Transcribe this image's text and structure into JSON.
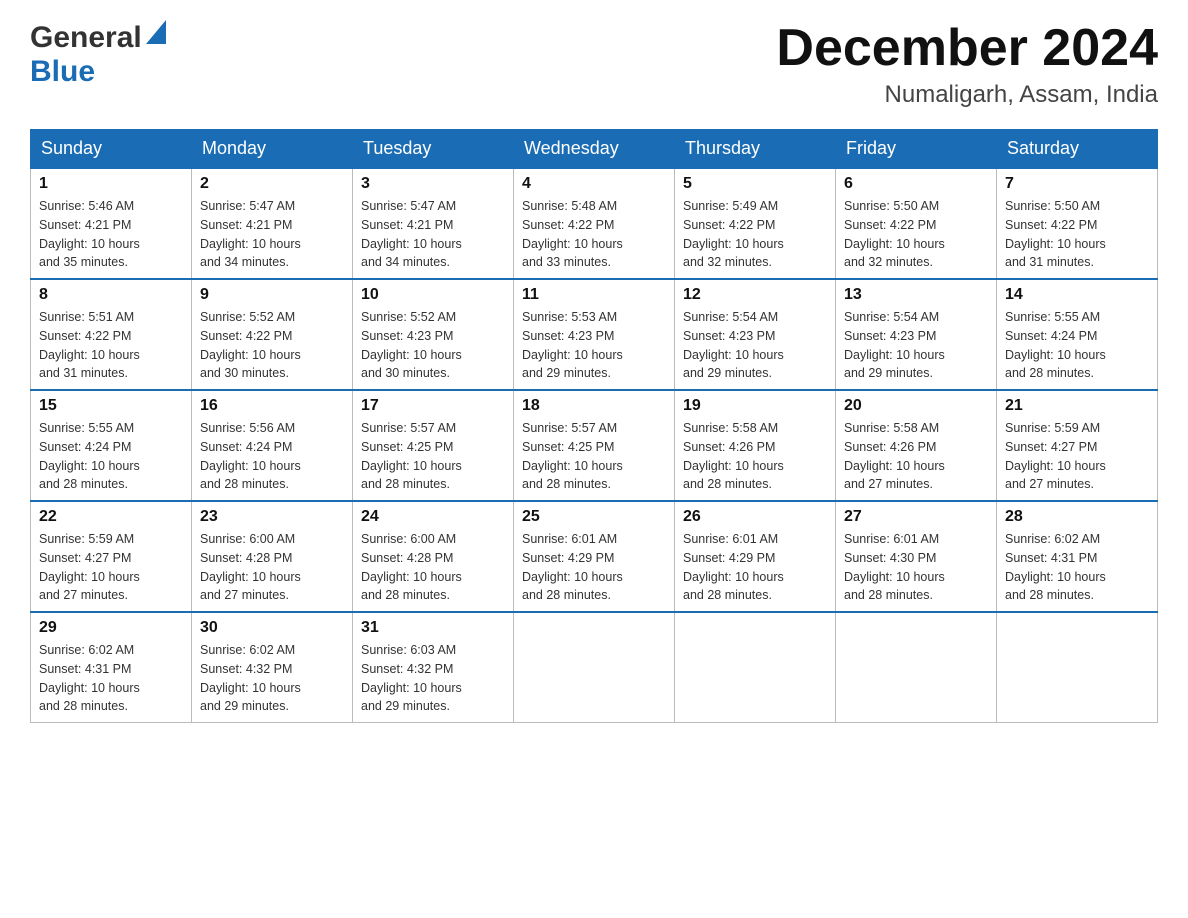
{
  "header": {
    "logo_general": "General",
    "logo_blue": "Blue",
    "month_title": "December 2024",
    "location": "Numaligarh, Assam, India"
  },
  "days_of_week": [
    "Sunday",
    "Monday",
    "Tuesday",
    "Wednesday",
    "Thursday",
    "Friday",
    "Saturday"
  ],
  "weeks": [
    [
      {
        "day": "1",
        "sunrise": "5:46 AM",
        "sunset": "4:21 PM",
        "daylight": "10 hours and 35 minutes."
      },
      {
        "day": "2",
        "sunrise": "5:47 AM",
        "sunset": "4:21 PM",
        "daylight": "10 hours and 34 minutes."
      },
      {
        "day": "3",
        "sunrise": "5:47 AM",
        "sunset": "4:21 PM",
        "daylight": "10 hours and 34 minutes."
      },
      {
        "day": "4",
        "sunrise": "5:48 AM",
        "sunset": "4:22 PM",
        "daylight": "10 hours and 33 minutes."
      },
      {
        "day": "5",
        "sunrise": "5:49 AM",
        "sunset": "4:22 PM",
        "daylight": "10 hours and 32 minutes."
      },
      {
        "day": "6",
        "sunrise": "5:50 AM",
        "sunset": "4:22 PM",
        "daylight": "10 hours and 32 minutes."
      },
      {
        "day": "7",
        "sunrise": "5:50 AM",
        "sunset": "4:22 PM",
        "daylight": "10 hours and 31 minutes."
      }
    ],
    [
      {
        "day": "8",
        "sunrise": "5:51 AM",
        "sunset": "4:22 PM",
        "daylight": "10 hours and 31 minutes."
      },
      {
        "day": "9",
        "sunrise": "5:52 AM",
        "sunset": "4:22 PM",
        "daylight": "10 hours and 30 minutes."
      },
      {
        "day": "10",
        "sunrise": "5:52 AM",
        "sunset": "4:23 PM",
        "daylight": "10 hours and 30 minutes."
      },
      {
        "day": "11",
        "sunrise": "5:53 AM",
        "sunset": "4:23 PM",
        "daylight": "10 hours and 29 minutes."
      },
      {
        "day": "12",
        "sunrise": "5:54 AM",
        "sunset": "4:23 PM",
        "daylight": "10 hours and 29 minutes."
      },
      {
        "day": "13",
        "sunrise": "5:54 AM",
        "sunset": "4:23 PM",
        "daylight": "10 hours and 29 minutes."
      },
      {
        "day": "14",
        "sunrise": "5:55 AM",
        "sunset": "4:24 PM",
        "daylight": "10 hours and 28 minutes."
      }
    ],
    [
      {
        "day": "15",
        "sunrise": "5:55 AM",
        "sunset": "4:24 PM",
        "daylight": "10 hours and 28 minutes."
      },
      {
        "day": "16",
        "sunrise": "5:56 AM",
        "sunset": "4:24 PM",
        "daylight": "10 hours and 28 minutes."
      },
      {
        "day": "17",
        "sunrise": "5:57 AM",
        "sunset": "4:25 PM",
        "daylight": "10 hours and 28 minutes."
      },
      {
        "day": "18",
        "sunrise": "5:57 AM",
        "sunset": "4:25 PM",
        "daylight": "10 hours and 28 minutes."
      },
      {
        "day": "19",
        "sunrise": "5:58 AM",
        "sunset": "4:26 PM",
        "daylight": "10 hours and 28 minutes."
      },
      {
        "day": "20",
        "sunrise": "5:58 AM",
        "sunset": "4:26 PM",
        "daylight": "10 hours and 27 minutes."
      },
      {
        "day": "21",
        "sunrise": "5:59 AM",
        "sunset": "4:27 PM",
        "daylight": "10 hours and 27 minutes."
      }
    ],
    [
      {
        "day": "22",
        "sunrise": "5:59 AM",
        "sunset": "4:27 PM",
        "daylight": "10 hours and 27 minutes."
      },
      {
        "day": "23",
        "sunrise": "6:00 AM",
        "sunset": "4:28 PM",
        "daylight": "10 hours and 27 minutes."
      },
      {
        "day": "24",
        "sunrise": "6:00 AM",
        "sunset": "4:28 PM",
        "daylight": "10 hours and 28 minutes."
      },
      {
        "day": "25",
        "sunrise": "6:01 AM",
        "sunset": "4:29 PM",
        "daylight": "10 hours and 28 minutes."
      },
      {
        "day": "26",
        "sunrise": "6:01 AM",
        "sunset": "4:29 PM",
        "daylight": "10 hours and 28 minutes."
      },
      {
        "day": "27",
        "sunrise": "6:01 AM",
        "sunset": "4:30 PM",
        "daylight": "10 hours and 28 minutes."
      },
      {
        "day": "28",
        "sunrise": "6:02 AM",
        "sunset": "4:31 PM",
        "daylight": "10 hours and 28 minutes."
      }
    ],
    [
      {
        "day": "29",
        "sunrise": "6:02 AM",
        "sunset": "4:31 PM",
        "daylight": "10 hours and 28 minutes."
      },
      {
        "day": "30",
        "sunrise": "6:02 AM",
        "sunset": "4:32 PM",
        "daylight": "10 hours and 29 minutes."
      },
      {
        "day": "31",
        "sunrise": "6:03 AM",
        "sunset": "4:32 PM",
        "daylight": "10 hours and 29 minutes."
      },
      null,
      null,
      null,
      null
    ]
  ],
  "labels": {
    "sunrise": "Sunrise:",
    "sunset": "Sunset:",
    "daylight": "Daylight:"
  }
}
